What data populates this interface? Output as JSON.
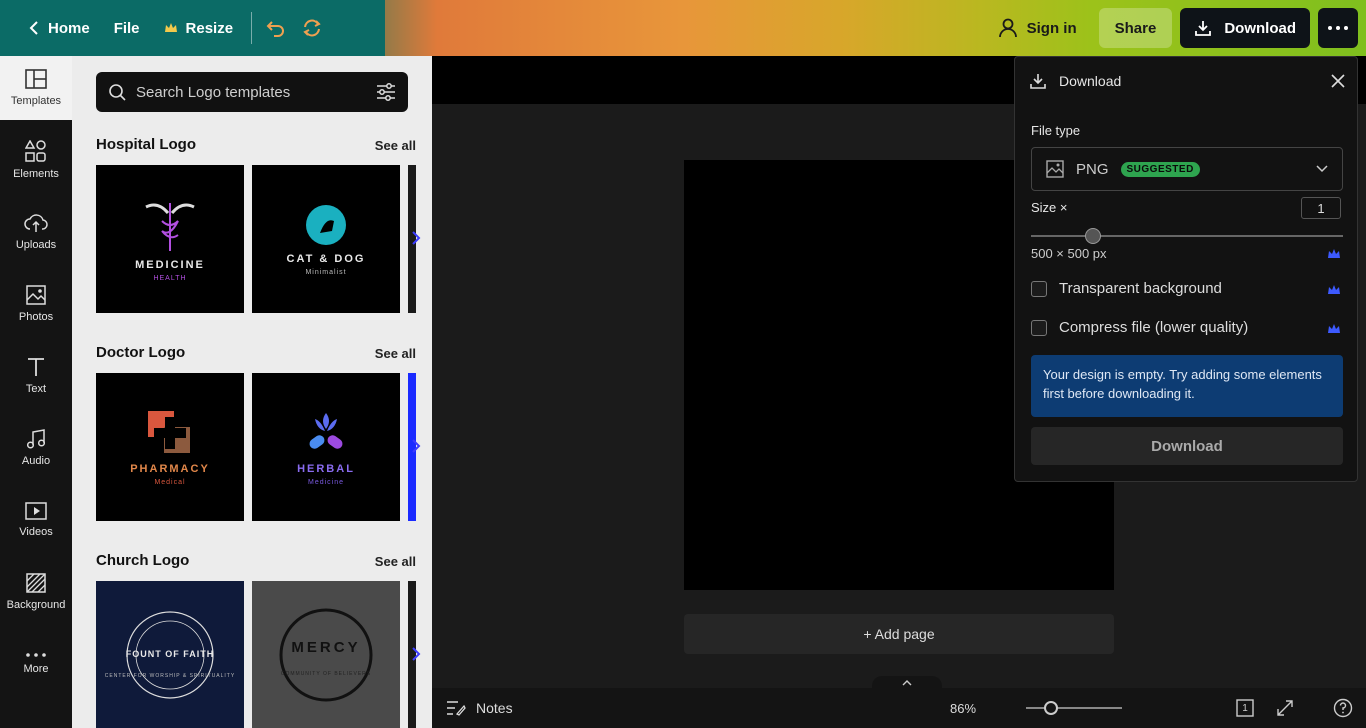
{
  "topbar": {
    "home": "Home",
    "file": "File",
    "resize": "Resize",
    "sign_in": "Sign in",
    "share": "Share",
    "download": "Download"
  },
  "rail": {
    "items": [
      {
        "label": "Templates"
      },
      {
        "label": "Elements"
      },
      {
        "label": "Uploads"
      },
      {
        "label": "Photos"
      },
      {
        "label": "Text"
      },
      {
        "label": "Audio"
      },
      {
        "label": "Videos"
      },
      {
        "label": "Background"
      },
      {
        "label": "More"
      }
    ]
  },
  "panel": {
    "search_placeholder": "Search Logo templates",
    "sections": [
      {
        "title": "Hospital Logo",
        "see_all": "See all",
        "tiles": [
          {
            "main": "MEDICINE",
            "sub": "HEALTH"
          },
          {
            "main": "CAT & DOG",
            "sub": "Minimalist"
          }
        ]
      },
      {
        "title": "Doctor Logo",
        "see_all": "See all",
        "tiles": [
          {
            "main": "PHARMACY",
            "sub": "Medical"
          },
          {
            "main": "HERBAL",
            "sub": "Medicine"
          }
        ]
      },
      {
        "title": "Church Logo",
        "see_all": "See all",
        "tiles": [
          {
            "main": "FOUNT OF FAITH",
            "sub": "CENTER FOR WORSHIP & SPIRITUALITY"
          },
          {
            "main": "MERCY",
            "sub": "COMMUNITY OF BELIEVERS"
          }
        ]
      }
    ]
  },
  "canvas": {
    "add_page": "+ Add page"
  },
  "bottombar": {
    "notes": "Notes",
    "zoom": "86%",
    "page_number": "1"
  },
  "download_panel": {
    "title": "Download",
    "file_type_label": "File type",
    "file_type_value": "PNG",
    "suggested_badge": "SUGGESTED",
    "size_label": "Size ×",
    "size_value": "1",
    "size_fraction": 0.2,
    "dimensions": "500 × 500 px",
    "transparent_bg": "Transparent background",
    "compress": "Compress file (lower quality)",
    "notice": "Your design is empty. Try adding some elements first before downloading it.",
    "action": "Download"
  },
  "colors": {
    "accent_blue": "#3b3bff",
    "badge_green": "#2ea44f",
    "notice_blue": "#0d3c73",
    "crown_blue": "#3d5afe"
  }
}
